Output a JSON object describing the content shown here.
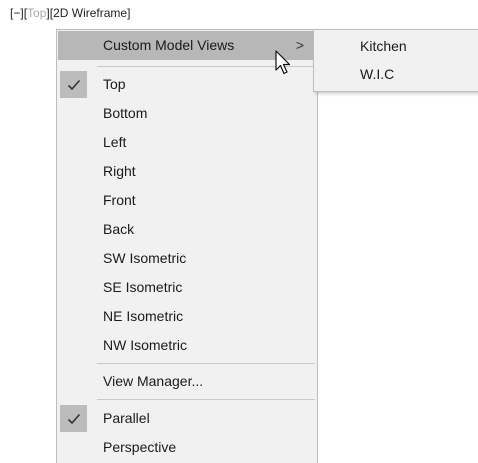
{
  "viewport_label": {
    "minimize": "[−]",
    "bracket_open": "[",
    "view": "Top",
    "bracket_close": "]",
    "visual_style": "[2D Wireframe]"
  },
  "menu": {
    "custom_model_views": "Custom Model Views",
    "submenu_arrow": ">",
    "views": {
      "top": "Top",
      "bottom": "Bottom",
      "left": "Left",
      "right": "Right",
      "front": "Front",
      "back": "Back",
      "sw_isometric": "SW Isometric",
      "se_isometric": "SE Isometric",
      "ne_isometric": "NE Isometric",
      "nw_isometric": "NW Isometric"
    },
    "view_manager": "View Manager...",
    "projection": {
      "parallel": "Parallel",
      "perspective": "Perspective"
    },
    "checked": [
      "Top",
      "Parallel"
    ]
  },
  "submenu": {
    "items": [
      "Kitchen",
      "W.I.C"
    ]
  },
  "icons": {
    "check": "check-icon",
    "cursor": "mouse-pointer-icon",
    "arrow": "chevron-right-icon"
  },
  "colors": {
    "highlight": "#b7b7b7",
    "menu_bg": "#f1f1f1",
    "dim_text": "#a8a8a8"
  }
}
